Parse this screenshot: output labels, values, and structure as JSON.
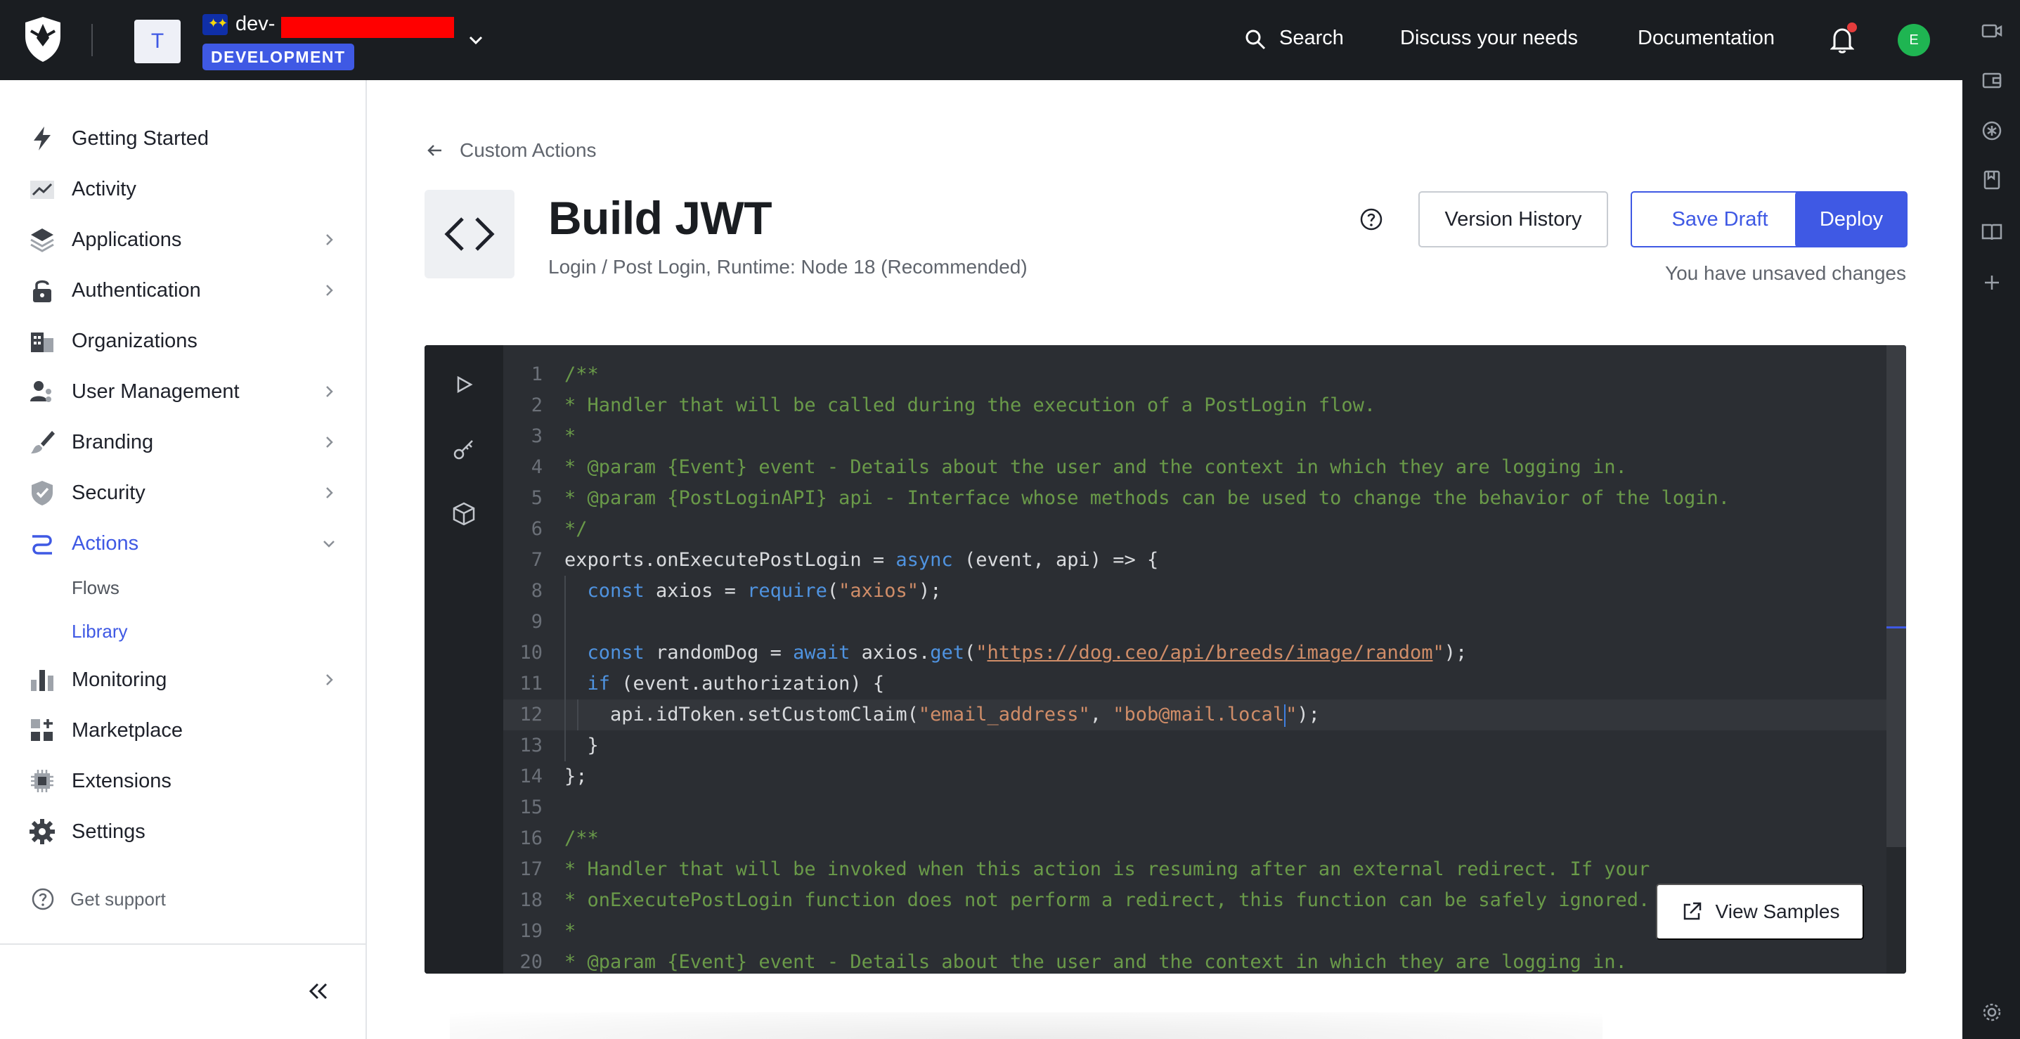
{
  "topbar": {
    "tenant_initial": "T",
    "tenant_name": "dev-",
    "environment_badge": "DEVELOPMENT",
    "search_label": "Search",
    "discuss_label": "Discuss your needs",
    "documentation_label": "Documentation",
    "user_initial": "E"
  },
  "sidebar": {
    "items": [
      {
        "label": "Getting Started",
        "icon": "lightning-icon"
      },
      {
        "label": "Activity",
        "icon": "activity-chart-icon"
      },
      {
        "label": "Applications",
        "icon": "layers-icon"
      },
      {
        "label": "Authentication",
        "icon": "lock-icon"
      },
      {
        "label": "Organizations",
        "icon": "building-icon"
      },
      {
        "label": "User Management",
        "icon": "users-icon"
      },
      {
        "label": "Branding",
        "icon": "brush-icon"
      },
      {
        "label": "Security",
        "icon": "shield-icon"
      },
      {
        "label": "Actions",
        "icon": "actions-icon"
      },
      {
        "label": "Monitoring",
        "icon": "bar-chart-icon"
      },
      {
        "label": "Marketplace",
        "icon": "marketplace-icon"
      },
      {
        "label": "Extensions",
        "icon": "chip-icon"
      },
      {
        "label": "Settings",
        "icon": "gear-icon"
      }
    ],
    "actions_subitems": [
      "Flows",
      "Library"
    ],
    "support_label": "Get support"
  },
  "main": {
    "breadcrumb": "Custom Actions",
    "title": "Build JWT",
    "subtitle": "Login / Post Login, Runtime: Node 18 (Recommended)",
    "version_history_label": "Version History",
    "save_draft_label": "Save Draft",
    "deploy_label": "Deploy",
    "unsaved_label": "You have unsaved changes",
    "view_samples_label": "View Samples"
  },
  "colors": {
    "accent": "#3f59e4",
    "topbar": "#1a1d21",
    "editor_bg": "#2b2e33",
    "comment": "#6a9a49",
    "keyword": "#4f93e0",
    "string": "#d08d68"
  },
  "code_lines": [
    {
      "n": "1",
      "parts": [
        [
          "c-com",
          "/**"
        ]
      ]
    },
    {
      "n": "2",
      "parts": [
        [
          "c-com",
          "* Handler that will be called during the execution of a PostLogin flow."
        ]
      ]
    },
    {
      "n": "3",
      "parts": [
        [
          "c-com",
          "*"
        ]
      ]
    },
    {
      "n": "4",
      "parts": [
        [
          "c-com",
          "* @param {Event} event - Details about the user and the context in which they are logging in."
        ]
      ]
    },
    {
      "n": "5",
      "parts": [
        [
          "c-com",
          "* @param {PostLoginAPI} api - Interface whose methods can be used to change the behavior of the login."
        ]
      ]
    },
    {
      "n": "6",
      "parts": [
        [
          "c-com",
          "*/"
        ]
      ]
    },
    {
      "n": "7",
      "parts": [
        [
          "",
          "exports.onExecutePostLogin = "
        ],
        [
          "c-kw",
          "async"
        ],
        [
          "",
          " (event, api) => {"
        ]
      ]
    },
    {
      "n": "8",
      "parts": [
        [
          "",
          "  "
        ],
        [
          "c-kw",
          "const"
        ],
        [
          "",
          " axios = "
        ],
        [
          "c-kw",
          "require"
        ],
        [
          "",
          "("
        ],
        [
          "c-str",
          "\"axios\""
        ],
        [
          "",
          ");"
        ]
      ]
    },
    {
      "n": "9",
      "parts": [
        [
          "",
          ""
        ]
      ]
    },
    {
      "n": "10",
      "parts": [
        [
          "",
          "  "
        ],
        [
          "c-kw",
          "const"
        ],
        [
          "",
          " randomDog = "
        ],
        [
          "c-kw",
          "await"
        ],
        [
          "",
          " axios."
        ],
        [
          "c-kw",
          "get"
        ],
        [
          "",
          "("
        ],
        [
          "c-str",
          "\""
        ],
        [
          "c-url",
          "https://dog.ceo/api/breeds/image/random"
        ],
        [
          "c-str",
          "\""
        ],
        [
          "",
          ");"
        ]
      ]
    },
    {
      "n": "11",
      "parts": [
        [
          "",
          "  "
        ],
        [
          "c-kw",
          "if"
        ],
        [
          "",
          " (event.authorization) {"
        ]
      ]
    },
    {
      "n": "12",
      "parts": [
        [
          "",
          "    api.idToken.setCustomClaim("
        ],
        [
          "c-str",
          "\"email_address\""
        ],
        [
          "",
          ", "
        ],
        [
          "c-str",
          "\"bob@mail.local"
        ],
        [
          "caret",
          ""
        ],
        [
          "c-str",
          "\""
        ],
        [
          "",
          ");"
        ]
      ]
    },
    {
      "n": "13",
      "parts": [
        [
          "",
          "  }"
        ]
      ]
    },
    {
      "n": "14",
      "parts": [
        [
          "",
          "};"
        ]
      ]
    },
    {
      "n": "15",
      "parts": [
        [
          "",
          ""
        ]
      ]
    },
    {
      "n": "16",
      "parts": [
        [
          "c-com",
          "/**"
        ]
      ]
    },
    {
      "n": "17",
      "parts": [
        [
          "c-com",
          "* Handler that will be invoked when this action is resuming after an external redirect. If your"
        ]
      ]
    },
    {
      "n": "18",
      "parts": [
        [
          "c-com",
          "* onExecutePostLogin function does not perform a redirect, this function can be safely ignored."
        ]
      ]
    },
    {
      "n": "19",
      "parts": [
        [
          "c-com",
          "*"
        ]
      ]
    },
    {
      "n": "20",
      "parts": [
        [
          "c-com",
          "* @param {Event} event - Details about the user and the context in which they are logging in."
        ]
      ]
    }
  ]
}
